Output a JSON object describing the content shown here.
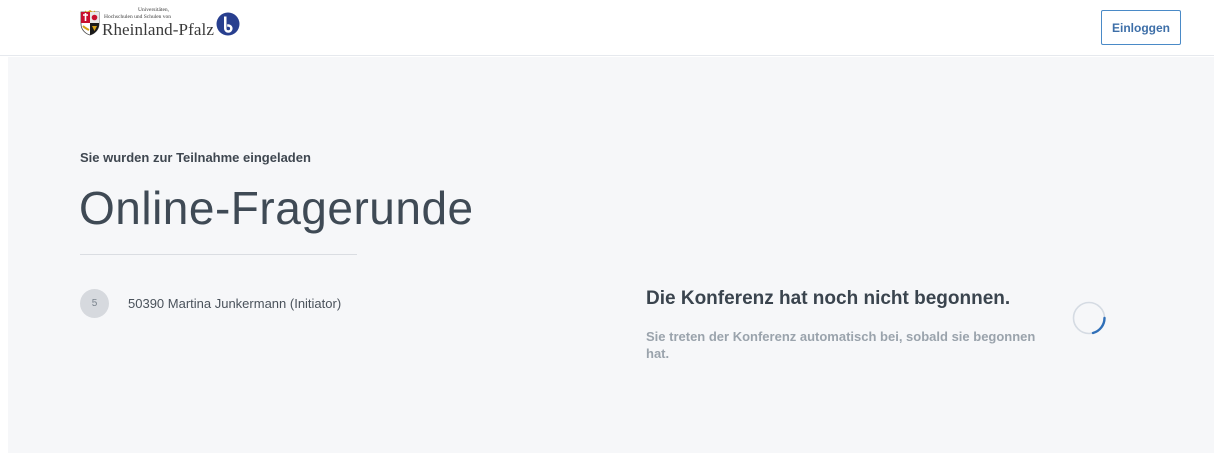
{
  "header": {
    "logo": {
      "line1": "Universitäten,",
      "line2": "Hochschulen und Schulen von",
      "line3": "Rheinland-Pfalz",
      "crest_icon": "coat-of-arms-icon",
      "brand_icon": "bigbluebutton-b-icon"
    },
    "login_label": "Einloggen"
  },
  "main": {
    "invite_text": "Sie wurden zur Teilnahme eingeladen",
    "room_title": "Online-Fragerunde",
    "owner": {
      "badge": "5",
      "name": "50390 Martina Junkermann (Initiator)"
    },
    "status": {
      "title": "Die Konferenz hat noch nicht begonnen.",
      "subtitle": "Sie treten der Konferenz automatisch bei, sobald sie begonnen hat.",
      "spinner_icon": "loading-spinner-icon"
    }
  },
  "colors": {
    "accent": "#3e6fa8",
    "background": "#f6f7f9",
    "title_text": "#3f4a55",
    "muted_text": "#9aa3ac"
  }
}
